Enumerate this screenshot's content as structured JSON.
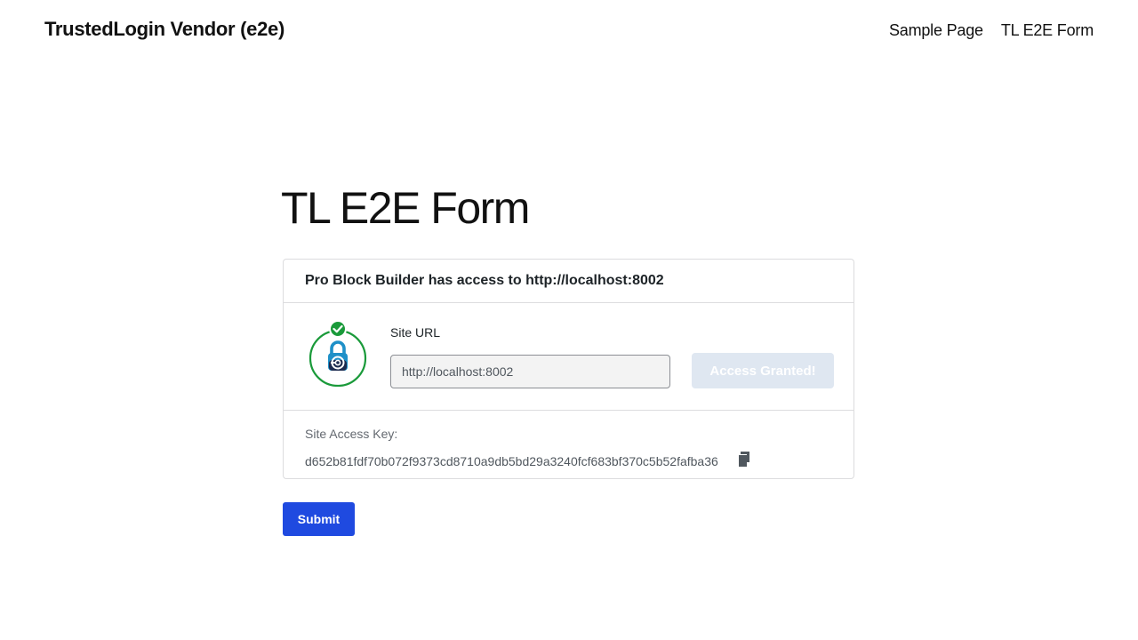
{
  "header": {
    "site_title": "TrustedLogin Vendor (e2e)",
    "nav": [
      "Sample Page",
      "TL E2E Form"
    ]
  },
  "page": {
    "title": "TL E2E Form"
  },
  "access_card": {
    "heading": "Pro Block Builder has access to http://localhost:8002",
    "logo_icon": "trustedlogin-lock-icon",
    "status_icon": "checkmark-icon",
    "site_url_label": "Site URL",
    "site_url_value": "http://localhost:8002",
    "access_button_label": "Access Granted!",
    "access_key_label": "Site Access Key:",
    "access_key_value": "d652b81fdf70b072f9373cd8710a9db5bd29a3240fcf683bf370c5b52fafba36",
    "copy_icon": "copy-icon"
  },
  "form": {
    "submit_label": "Submit"
  },
  "colors": {
    "accent": "#1f4ae0",
    "success": "#1a9a3a",
    "lock_blue": "#1e90c8",
    "lock_navy": "#1d2b4f",
    "disabled_button": "#dfe7f1"
  }
}
